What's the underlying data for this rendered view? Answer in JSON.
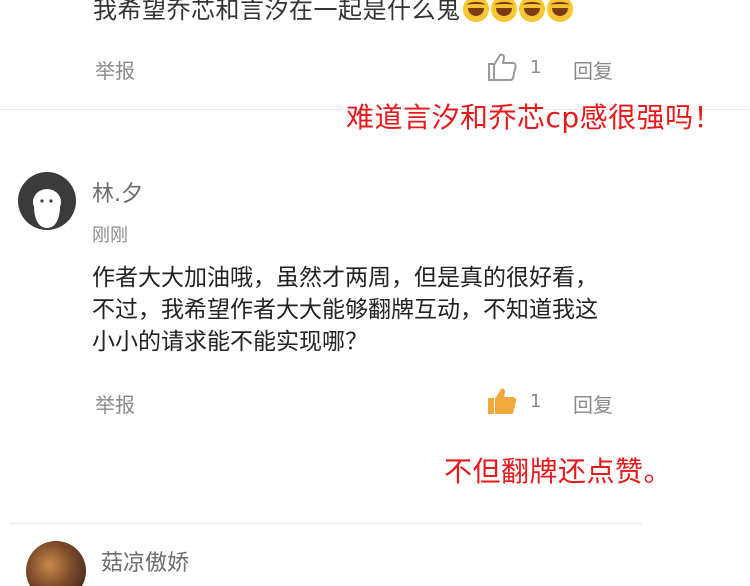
{
  "colors": {
    "annotation": "#e8181b",
    "like_active": "#f2a93b",
    "muted": "#8a8a8a"
  },
  "previous_comment": {
    "text": "我希望乔芯和言汐在一起是什么鬼",
    "emojis": [
      "laugh-cry-emoji",
      "laugh-cry-emoji",
      "laugh-cry-emoji",
      "laugh-cry-emoji"
    ],
    "report_label": "举报",
    "like_count": "1",
    "reply_label": "回复",
    "liked": false
  },
  "annotation_1": "难道言汐和乔芯cp感很强吗！",
  "comment": {
    "username": "林.夕",
    "time": "刚刚",
    "body": "作者大大加油哦，虽然才两周，但是真的很好看，不过，我希望作者大大能够翻牌互动，不知道我这小小的请求能不能实现哪？",
    "report_label": "举报",
    "like_count": "1",
    "reply_label": "回复",
    "liked": true
  },
  "annotation_2": "不但翻牌还点赞。",
  "next_comment": {
    "username": "菇凉傲娇"
  }
}
